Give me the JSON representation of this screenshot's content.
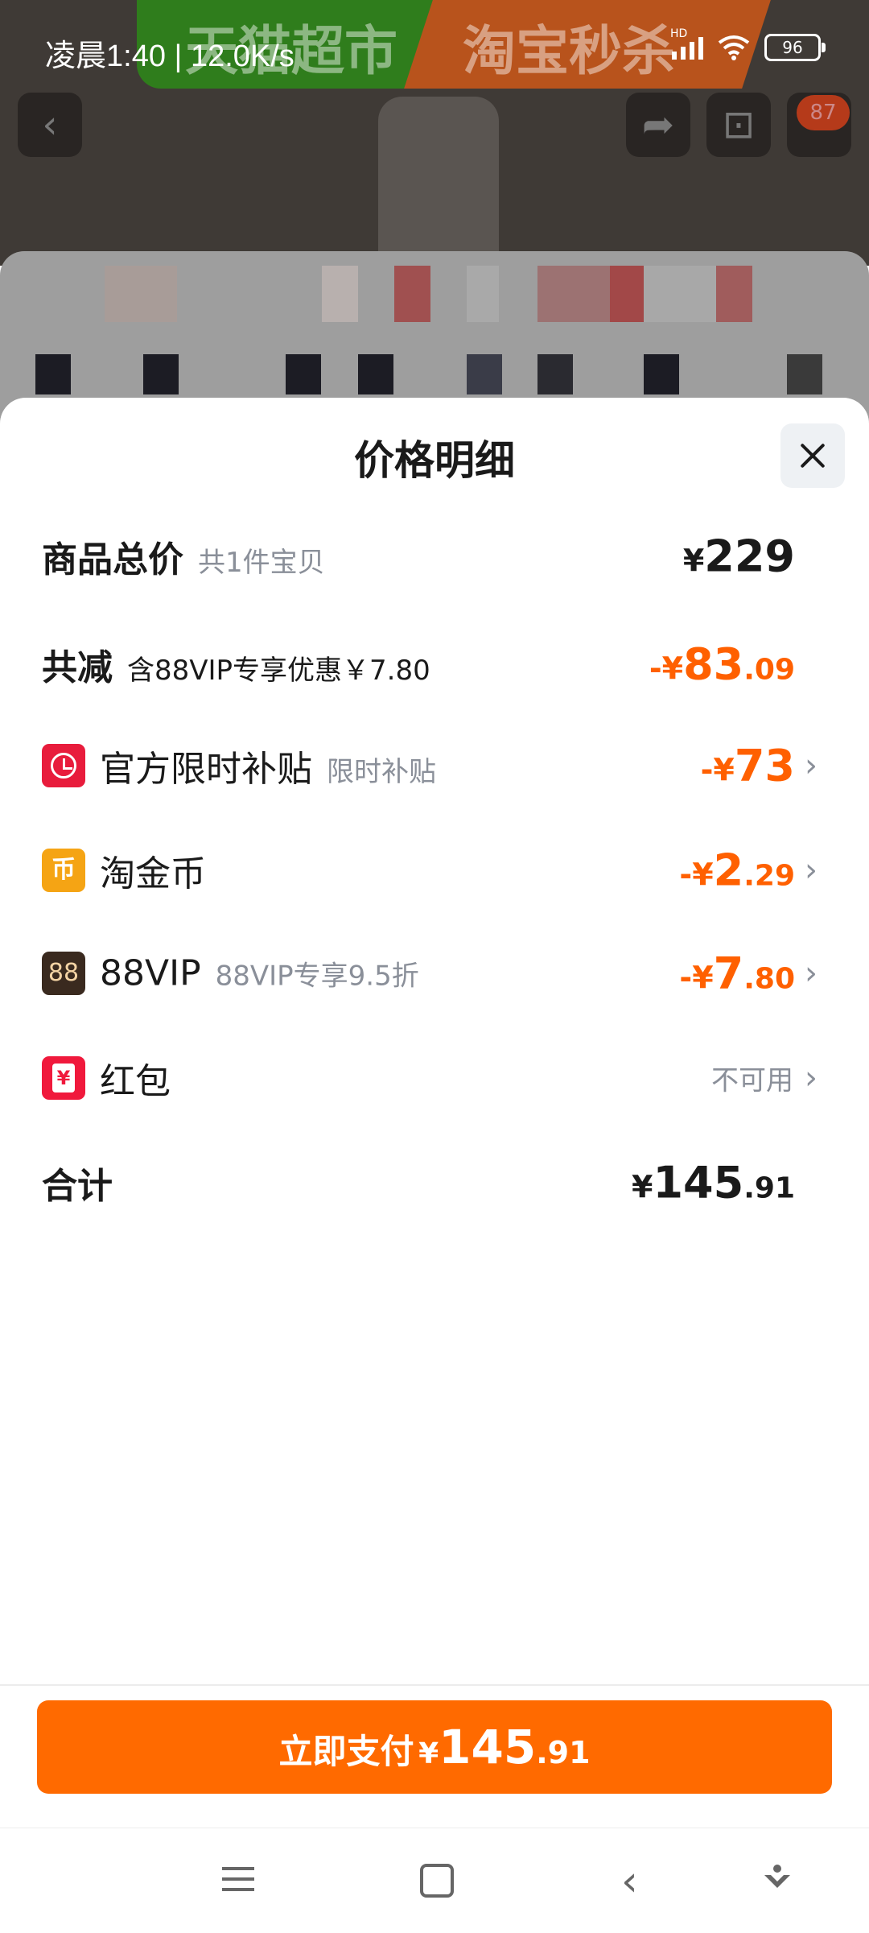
{
  "status_bar": {
    "time": "凌晨1:40 | 12.0K/s",
    "network_badge": "HD",
    "battery": "96"
  },
  "background": {
    "banner_left_text": "天猫超市",
    "banner_right_text": "淘宝秒杀",
    "cart_badge": "87"
  },
  "sheet": {
    "title": "价格明细",
    "rows": [
      {
        "label": "商品总价",
        "sub": "共1件宝贝",
        "currency": "¥",
        "int": "229",
        "dec": ""
      },
      {
        "label": "共减",
        "sub": "含88VIP专享优惠￥7.80",
        "currency": "-¥",
        "int": "83",
        "dec": ".09"
      },
      {
        "label": "官方限时补贴",
        "sub": "限时补贴",
        "currency": "-¥",
        "int": "73",
        "dec": "",
        "icon": "clock-icon"
      },
      {
        "label": "淘金币",
        "sub": "",
        "currency": "-¥",
        "int": "2",
        "dec": ".29",
        "icon": "gold-coin-icon",
        "icon_glyph": "币"
      },
      {
        "label": "88VIP",
        "sub": "88VIP专享9.5折",
        "currency": "-¥",
        "int": "7",
        "dec": ".80",
        "icon": "vip-88-icon",
        "icon_glyph": "88"
      },
      {
        "label": "红包",
        "sub": "",
        "status": "不可用",
        "icon": "red-envelope-icon"
      },
      {
        "label": "合计",
        "currency": "¥",
        "int": "145",
        "dec": ".91"
      }
    ],
    "pay_button": {
      "label": "立即支付",
      "currency": "¥",
      "int": "145",
      "dec": ".91"
    }
  },
  "colors": {
    "accent_orange": "#ff6000",
    "pay_button": "#ff6a00",
    "text_primary": "#1a1a1a",
    "text_secondary": "#8a8f99"
  }
}
